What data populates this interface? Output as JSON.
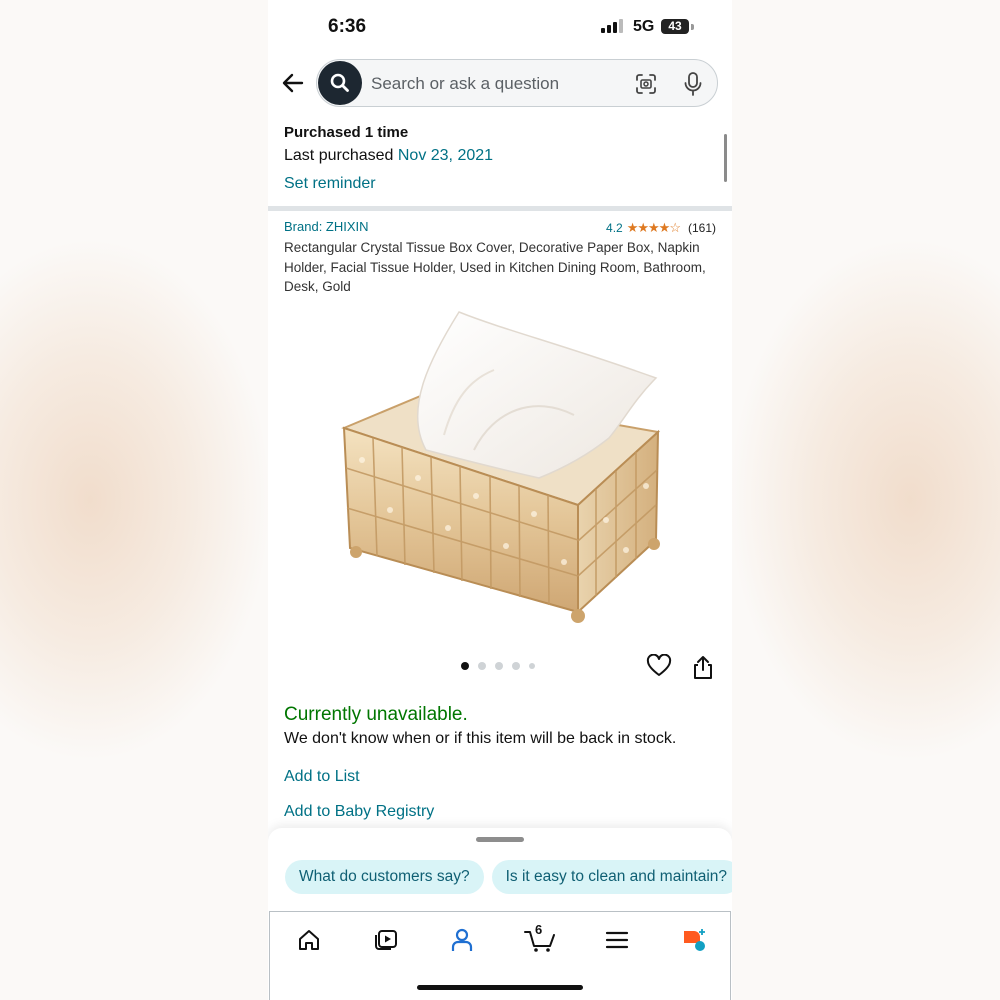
{
  "status_bar": {
    "time": "6:36",
    "network": "5G",
    "battery": "43"
  },
  "search": {
    "placeholder": "Search or ask a question"
  },
  "icons": {
    "back": "back-arrow-icon",
    "search": "search-icon",
    "camera": "camera-scan-icon",
    "mic": "microphone-icon",
    "heart": "heart-icon",
    "share": "share-icon",
    "home": "home-icon",
    "video": "video-icon",
    "account": "account-icon",
    "cart": "cart-icon",
    "menu": "menu-icon",
    "rufus": "rufus-ai-icon"
  },
  "purchase": {
    "count_text": "Purchased 1 time",
    "last_label": "Last purchased ",
    "last_date": "Nov 23, 2021",
    "reminder": "Set reminder"
  },
  "product": {
    "brand": "Brand: ZHIXIN",
    "rating": "4.2",
    "stars": "★★★★☆",
    "reviews": "(161)",
    "title": "Rectangular Crystal Tissue Box Cover, Decorative Paper Box, Napkin Holder, Facial Tissue Holder, Used in Kitchen Dining Room, Bathroom, Desk, Gold",
    "image_count": 5,
    "image_index": 1
  },
  "availability": {
    "status": "Currently unavailable.",
    "note": "We don't know when or if this item will be back in stock."
  },
  "actions": {
    "add_list": "Add to List",
    "add_baby": "Add to Baby Registry"
  },
  "suggestions": [
    "What do customers say?",
    "Is it easy to clean and maintain?"
  ],
  "nav": {
    "cart_count": "6"
  },
  "colors": {
    "link": "#007185",
    "available_green": "#007600",
    "star": "#de7921",
    "chip_bg": "#d9f4f7"
  }
}
